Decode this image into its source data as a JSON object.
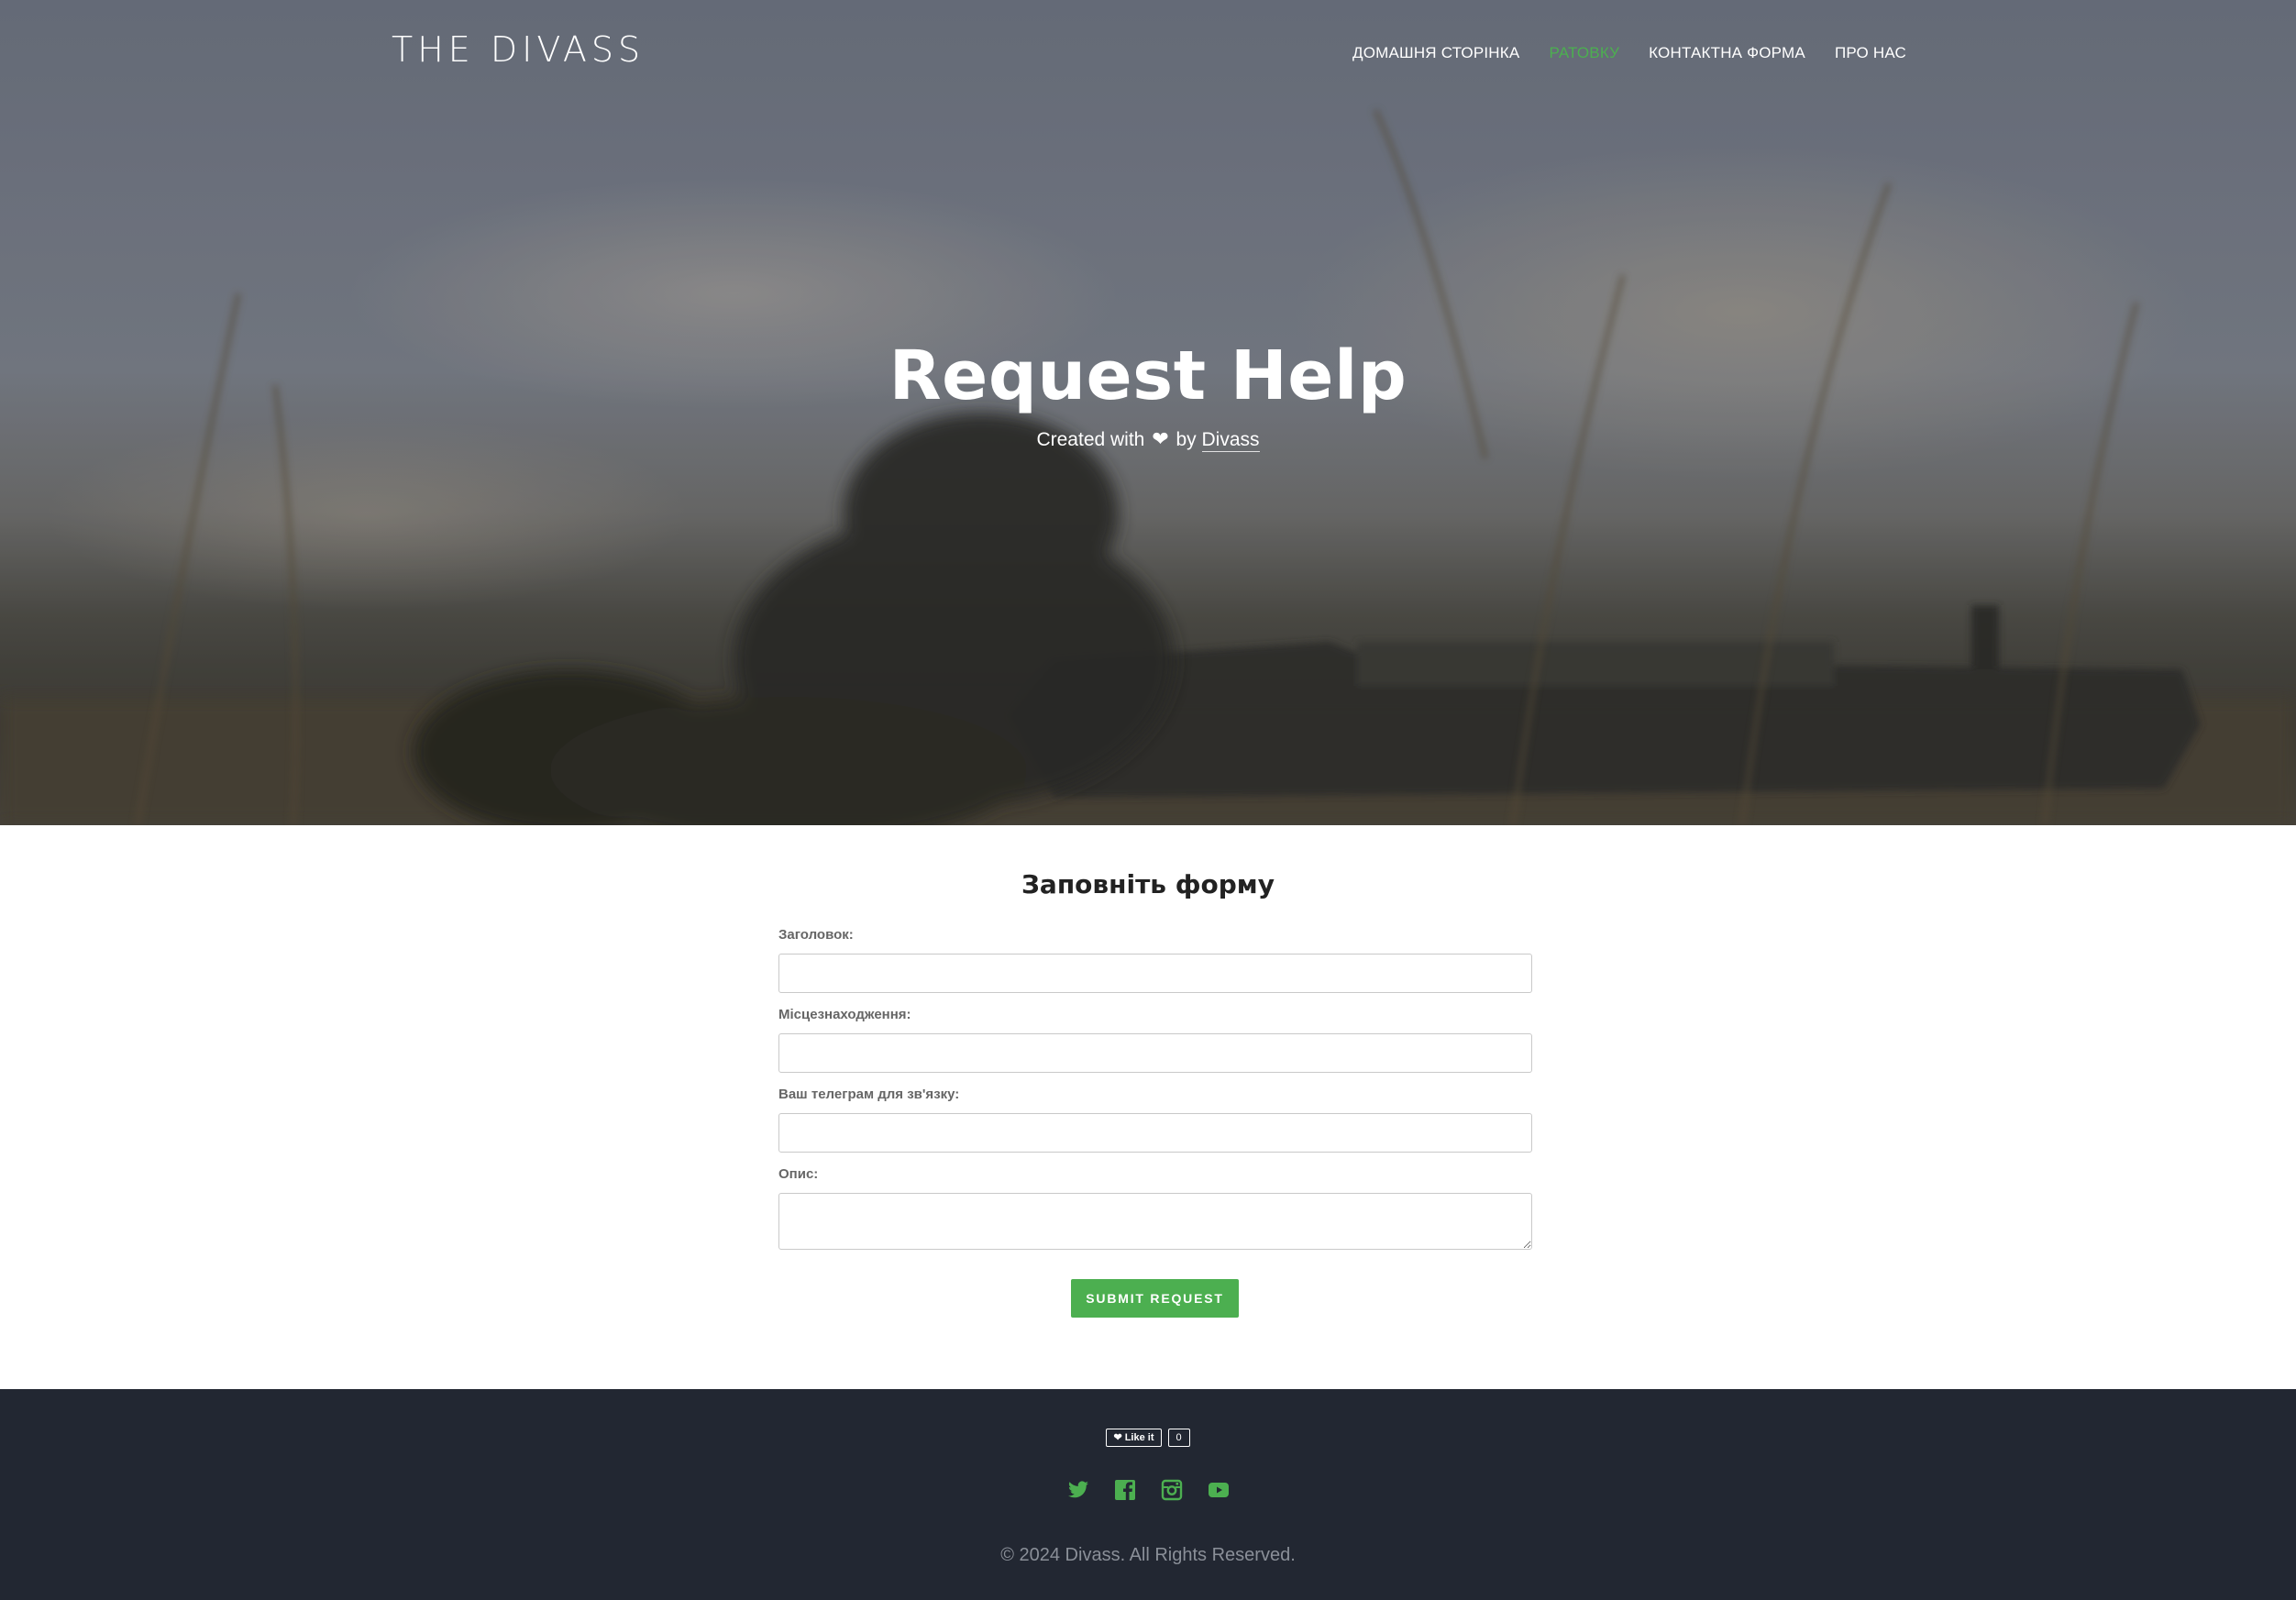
{
  "header": {
    "logo_text": "THE DIVASS",
    "nav": [
      {
        "label": "ДОМАШНЯ СТОРІНКА",
        "active": false
      },
      {
        "label": "РАТОВКУ",
        "active": true
      },
      {
        "label": "КОНТАКТНА ФОРМА",
        "active": false
      },
      {
        "label": "ПРО НАС",
        "active": false
      }
    ]
  },
  "hero": {
    "title": "Request Help",
    "subtitle_prefix": "Created with",
    "subtitle_by": "by",
    "subtitle_link": "Divass",
    "heart_icon": "heart-icon"
  },
  "form": {
    "title": "Заповніть форму",
    "fields": [
      {
        "label": "Заголовок:",
        "value": "",
        "placeholder": ""
      },
      {
        "label": "Місцезнаходження:",
        "value": "",
        "placeholder": ""
      },
      {
        "label": "Ваш телеграм для зв'язку:",
        "value": "",
        "placeholder": ""
      },
      {
        "label": "Опис:",
        "value": "",
        "placeholder": ""
      }
    ],
    "submit_label": "SUBMIT REQUEST"
  },
  "footer": {
    "like_label": "Like it",
    "like_count": "0",
    "social": [
      "twitter-icon",
      "facebook-icon",
      "instagram-icon",
      "youtube-icon"
    ],
    "copyright": "© 2024 Divass. All Rights Reserved."
  },
  "colors": {
    "accent": "#4caf50",
    "footer_bg": "#222732",
    "text_muted": "#8a8f98"
  }
}
